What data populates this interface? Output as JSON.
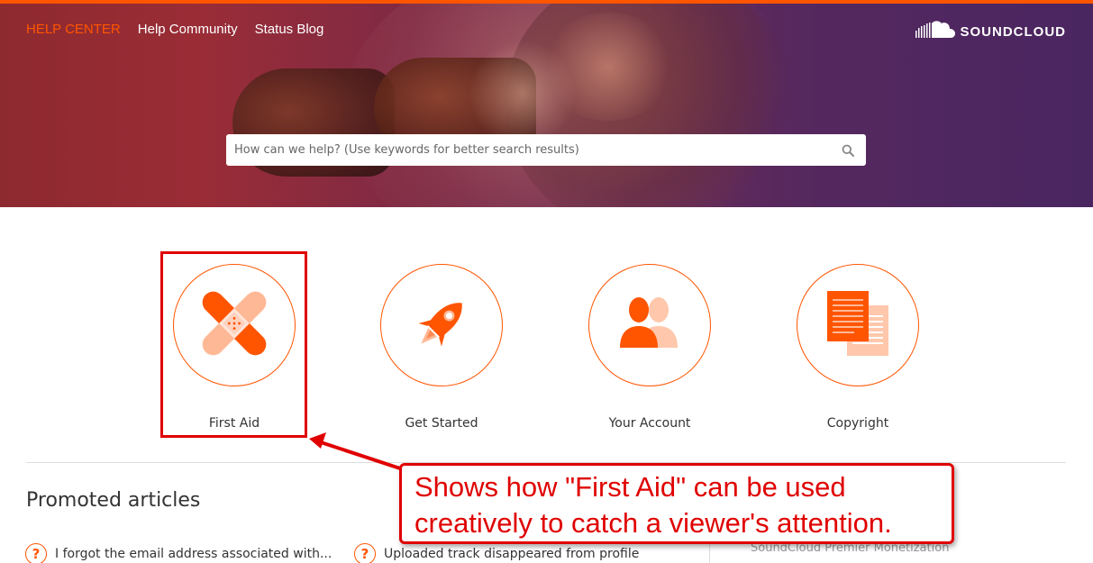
{
  "nav": {
    "help_center": "HELP CENTER",
    "help_community": "Help Community",
    "status_blog": "Status Blog"
  },
  "brand": {
    "name": "SOUNDCLOUD",
    "icon": "soundcloud-cloud-icon"
  },
  "search": {
    "placeholder": "How can we help? (Use keywords for better search results)",
    "icon": "search-icon"
  },
  "categories": [
    {
      "label": "First Aid",
      "icon": "bandage-icon"
    },
    {
      "label": "Get Started",
      "icon": "rocket-icon"
    },
    {
      "label": "Your Account",
      "icon": "users-icon"
    },
    {
      "label": "Copyright",
      "icon": "documents-icon"
    }
  ],
  "promoted": {
    "title": "Promoted articles",
    "articles": [
      {
        "text": "I forgot the email address associated with...",
        "icon": "question-icon"
      },
      {
        "text": "Uploaded track disappeared from profile",
        "icon": "question-icon"
      },
      {
        "text": "SoundCloud Premier Monetization"
      }
    ]
  },
  "annotation": {
    "text": "Shows how \"First Aid\" can be used creatively to catch a viewer's attention."
  },
  "colors": {
    "accent": "#ff5500",
    "annotation": "#e00000"
  }
}
